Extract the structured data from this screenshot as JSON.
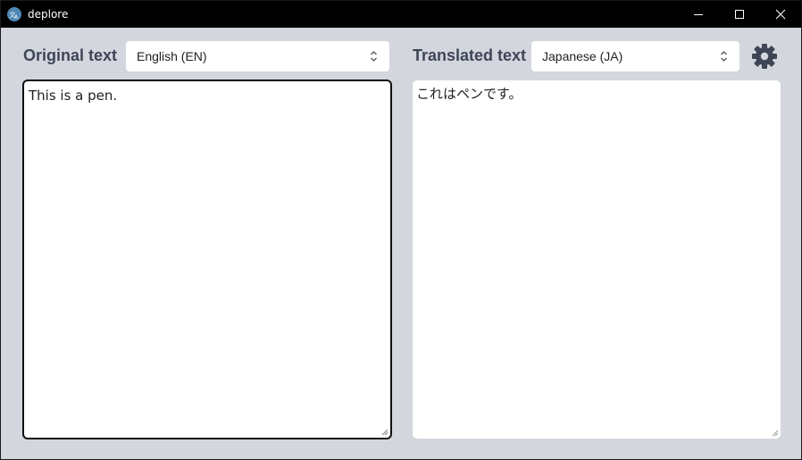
{
  "window": {
    "title": "deplore",
    "app_icon": "translate-icon",
    "controls": [
      "minimize-icon",
      "maximize-icon",
      "close-icon"
    ]
  },
  "source": {
    "label": "Original text",
    "language": "English (EN)",
    "text": "This is a pen."
  },
  "target": {
    "label": "Translated text",
    "language": "Japanese (JA)",
    "text": "これはペンです。"
  },
  "settings_icon": "gear-icon",
  "colors": {
    "background": "#d4d6de",
    "titlebar": "#000000",
    "label": "#3e4655",
    "icon_accent": "#3e4655"
  }
}
